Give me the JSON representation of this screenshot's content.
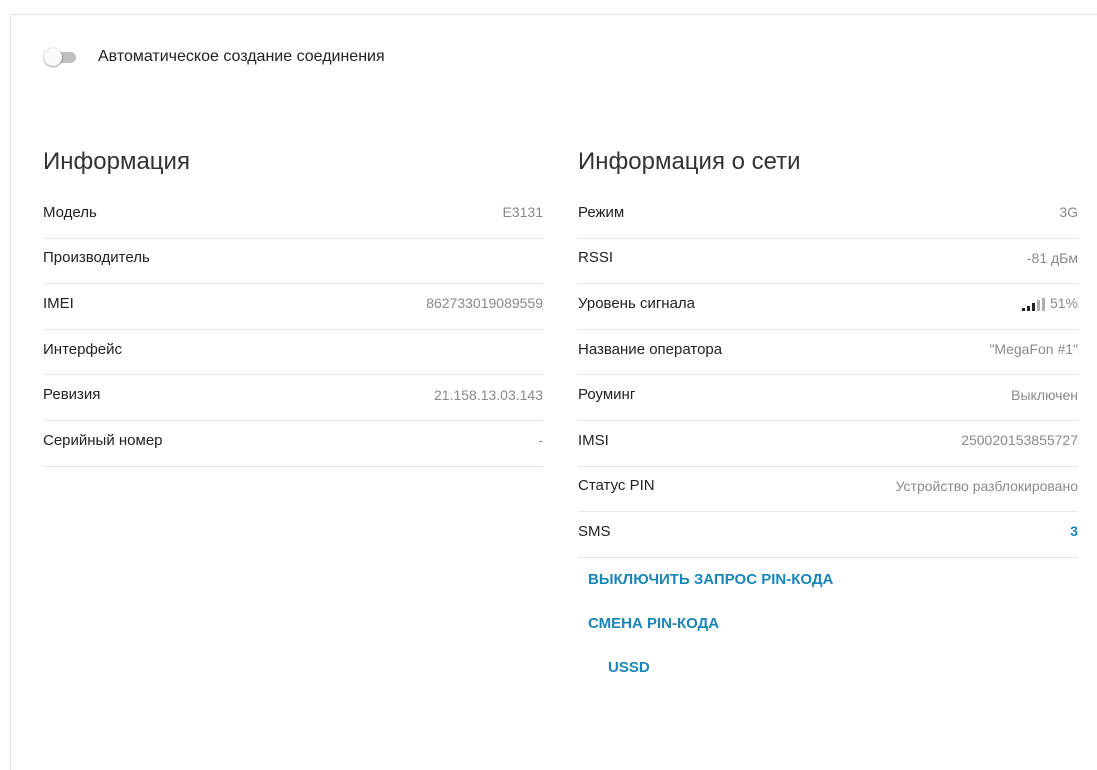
{
  "auto_connect": {
    "label": "Автоматическое создание соединения",
    "enabled": false
  },
  "info": {
    "title": "Информация",
    "rows": [
      {
        "key": "Модель",
        "value": "E3131"
      },
      {
        "key": "Производитель",
        "value": ""
      },
      {
        "key": "IMEI",
        "value": "862733019089559"
      },
      {
        "key": "Интерфейс",
        "value": ""
      },
      {
        "key": "Ревизия",
        "value": "21.158.13.03.143"
      },
      {
        "key": "Серийный номер",
        "value": "-"
      }
    ]
  },
  "network": {
    "title": "Информация о сети",
    "rows": {
      "mode": {
        "key": "Режим",
        "value": "3G"
      },
      "rssi": {
        "key": "RSSI",
        "value": "-81 дБм"
      },
      "signal": {
        "key": "Уровень сигнала",
        "value": "51%",
        "bars_active": 3,
        "bars_total": 5
      },
      "operator": {
        "key": "Название оператора",
        "value": "\"MegaFon #1\""
      },
      "roaming": {
        "key": "Роуминг",
        "value": "Выключен"
      },
      "imsi": {
        "key": "IMSI",
        "value": "250020153855727"
      },
      "pin_status": {
        "key": "Статус PIN",
        "value": "Устройство разблокировано"
      },
      "sms": {
        "key": "SMS",
        "value": "3"
      }
    },
    "actions": {
      "disable_pin": "ВЫКЛЮЧИТЬ ЗАПРОС PIN-КОДА",
      "change_pin": "СМЕНА PIN-КОДА",
      "ussd": "USSD"
    }
  },
  "colors": {
    "accent": "#1a86b8",
    "value_gray": "#8a8a8a",
    "divider": "#e6e6e6"
  }
}
